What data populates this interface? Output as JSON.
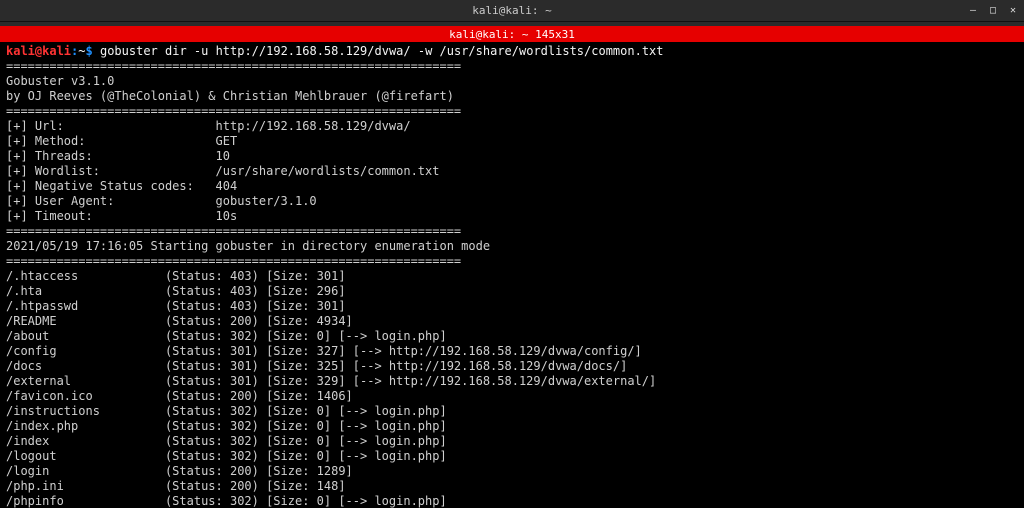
{
  "window": {
    "title": "kali@kali: ~",
    "tab_label": "kali@kali: ~ 145x31"
  },
  "prompt": {
    "user": "kali@kali",
    "sep": ":",
    "path": "~",
    "end": "$"
  },
  "command": "gobuster dir -u http://192.168.58.129/dvwa/ -w /usr/share/wordlists/common.txt",
  "divider": "===============================================================",
  "banner": {
    "line1": "Gobuster v3.1.0",
    "line2": "by OJ Reeves (@TheColonial) & Christian Mehlbrauer (@firefart)"
  },
  "config": {
    "url": "[+] Url:                     http://192.168.58.129/dvwa/",
    "method": "[+] Method:                  GET",
    "threads": "[+] Threads:                 10",
    "wordlist": "[+] Wordlist:                /usr/share/wordlists/common.txt",
    "negcodes": "[+] Negative Status codes:   404",
    "ua": "[+] User Agent:              gobuster/3.1.0",
    "timeout": "[+] Timeout:                 10s"
  },
  "start_line": "2021/05/19 17:16:05 Starting gobuster in directory enumeration mode",
  "results": [
    "/.htaccess            (Status: 403) [Size: 301]",
    "/.hta                 (Status: 403) [Size: 296]",
    "/.htpasswd            (Status: 403) [Size: 301]",
    "/README               (Status: 200) [Size: 4934]",
    "/about                (Status: 302) [Size: 0] [--> login.php]",
    "/config               (Status: 301) [Size: 327] [--> http://192.168.58.129/dvwa/config/]",
    "/docs                 (Status: 301) [Size: 325] [--> http://192.168.58.129/dvwa/docs/]",
    "/external             (Status: 301) [Size: 329] [--> http://192.168.58.129/dvwa/external/]",
    "/favicon.ico          (Status: 200) [Size: 1406]",
    "/instructions         (Status: 302) [Size: 0] [--> login.php]",
    "/index.php            (Status: 302) [Size: 0] [--> login.php]",
    "/index                (Status: 302) [Size: 0] [--> login.php]",
    "/logout               (Status: 302) [Size: 0] [--> login.php]",
    "/login                (Status: 200) [Size: 1289]",
    "/php.ini              (Status: 200) [Size: 148]",
    "/phpinfo              (Status: 302) [Size: 0] [--> login.php]"
  ]
}
